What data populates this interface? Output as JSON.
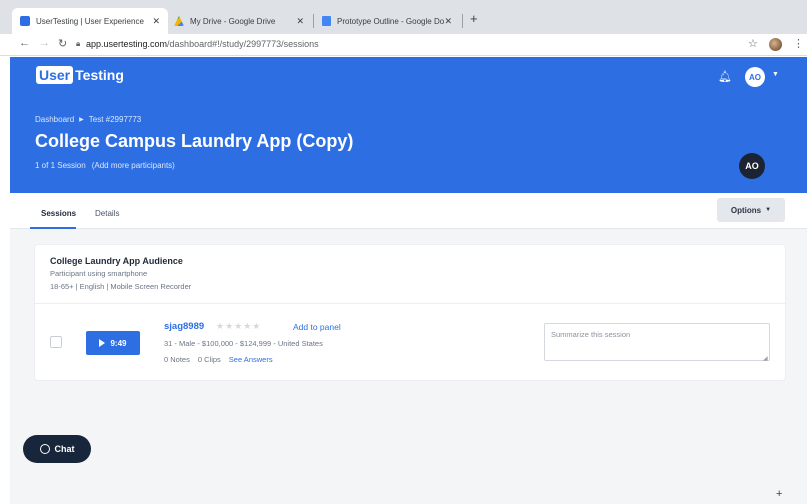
{
  "browser": {
    "tabs": [
      {
        "title": "UserTesting | User Experience",
        "close": "✕",
        "favicon_color": "#2d6fe3"
      },
      {
        "title": "My Drive - Google Drive",
        "close": "✕",
        "favicon_color": "#f4b400"
      },
      {
        "title": "Prototype Outline - Google Do",
        "close": "✕",
        "favicon_color": "#4285f4"
      }
    ],
    "new_tab": "+",
    "url_host": "app.usertesting.com",
    "url_path": "/dashboard#!/study/2997773/sessions"
  },
  "header": {
    "logo_box": "User",
    "logo_rest": "Testing",
    "user_initials": "AO",
    "breadcrumb": {
      "item1": "Dashboard",
      "separator": "▶",
      "item2": "Test #2997773"
    },
    "title": "College Campus Laundry App (Copy)",
    "session_count": "1 of 1 Session",
    "add_participants": "(Add more participants)",
    "owner_initials": "AO"
  },
  "tabs": {
    "sessions": "Sessions",
    "details": "Details",
    "options": "Options"
  },
  "audience": {
    "title": "College Laundry App Audience",
    "subtitle": "Participant using smartphone",
    "meta": "18-65+ | English | Mobile Screen Recorder"
  },
  "session": {
    "duration": "9:49",
    "username": "sjag8989",
    "stars": "★★★★★",
    "rating": 0,
    "add_to_panel": "Add to panel",
    "demographics": "31 - Male - $100,000 - $124,999 - United States",
    "notes": "0 Notes",
    "clips": "0 Clips",
    "see_answers": "See Answers",
    "summary_placeholder": "Summarize this session"
  },
  "chat": {
    "label": "Chat"
  },
  "colors": {
    "brand_blue": "#2d6fe3",
    "dark_navy": "#17263a"
  }
}
